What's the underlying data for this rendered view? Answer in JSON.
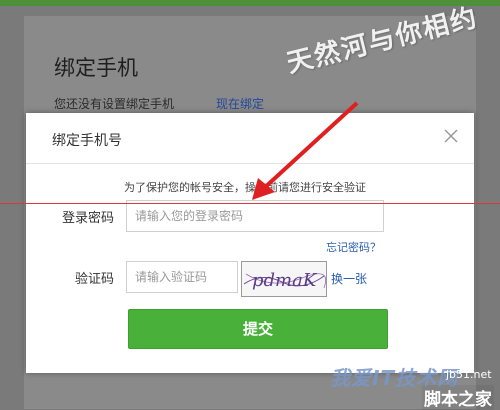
{
  "background": {
    "title": "绑定手机",
    "description": "您还没有设置绑定手机",
    "link": "现在绑定"
  },
  "watermark_top": "天然河与你相约",
  "modal": {
    "title": "绑定手机号",
    "hint": "为了保护您的帐号安全，操作前请您进行安全验证",
    "password": {
      "label": "登录密码",
      "placeholder": "请输入您的登录密码"
    },
    "forgot_link": "忘记密码？",
    "captcha": {
      "label": "验证码",
      "placeholder": "请输入验证码",
      "image_text": "pdmaK",
      "refresh_link": "换一张"
    },
    "submit_label": "提交"
  },
  "watermark_bottom": {
    "brand": "我爱IT技术网",
    "url": "jb51.net",
    "site": "脚本之家"
  },
  "colors": {
    "accent_green": "#49b13a",
    "link_blue": "#2a5db0",
    "arrow_red": "#e02020"
  }
}
